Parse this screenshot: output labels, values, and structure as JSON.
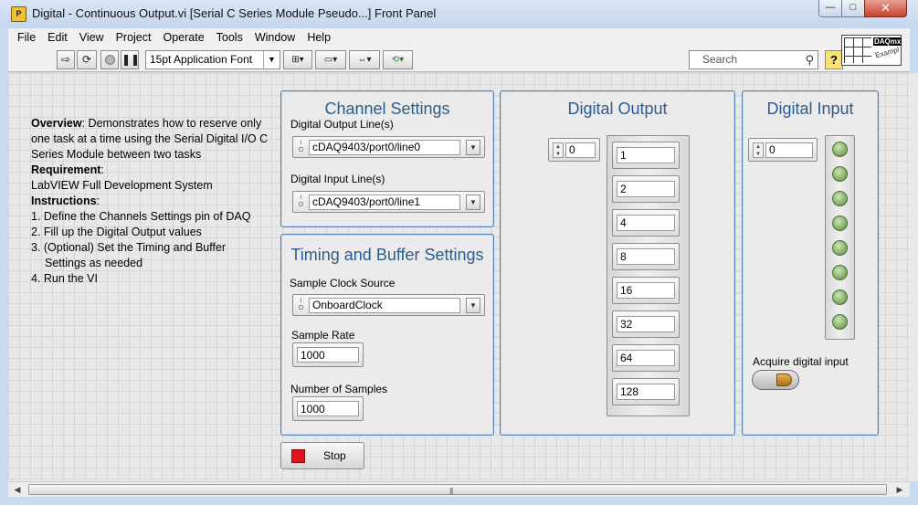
{
  "window": {
    "title": "Digital - Continuous Output.vi [Serial C Series Module Pseudo...] Front Panel",
    "minimize": "—",
    "maximize": "□",
    "close": "✕"
  },
  "menu": [
    "File",
    "Edit",
    "View",
    "Project",
    "Operate",
    "Tools",
    "Window",
    "Help"
  ],
  "toolbar": {
    "font": "15pt Application Font",
    "search_placeholder": "Search",
    "help": "?"
  },
  "vi_icon": {
    "line1": "DAQmx",
    "line2": "Exampl"
  },
  "overview": {
    "overview_label": "Overview",
    "overview_text": ": Demonstrates how to reserve only one task at a time using the Serial Digital I/O C Series Module between two tasks",
    "requirement_label": "Requirement",
    "requirement_colon": ":",
    "requirement_text": "LabVIEW Full Development System",
    "instructions_label": "Instructions",
    "instructions_colon": ":",
    "steps": [
      "1. Define the Channels Settings pin of DAQ",
      "2. Fill up the Digital Output values",
      "3. (Optional) Set the Timing and Buffer",
      "Settings as needed",
      "4. Run the VI"
    ]
  },
  "channel_settings": {
    "title": "Channel Settings",
    "output_label": "Digital Output Line(s)",
    "output_value": "cDAQ9403/port0/line0",
    "input_label": "Digital Input Line(s)",
    "input_value": "cDAQ9403/port0/line1"
  },
  "timing": {
    "title": "Timing and Buffer Settings",
    "clock_label": "Sample Clock Source",
    "clock_value": "OnboardClock",
    "rate_label": "Sample Rate",
    "rate_value": "1000",
    "samples_label": "Number of Samples",
    "samples_value": "1000"
  },
  "digital_output": {
    "title": "Digital Output",
    "index": "0",
    "values": [
      "1",
      "2",
      "4",
      "8",
      "16",
      "32",
      "64",
      "128"
    ]
  },
  "digital_input": {
    "title": "Digital Input",
    "index": "0",
    "led_count": 8,
    "led_color": "#7aa65a",
    "acquire_label": "Acquire digital input"
  },
  "stop": {
    "label": "Stop",
    "color": "#e0141b"
  }
}
